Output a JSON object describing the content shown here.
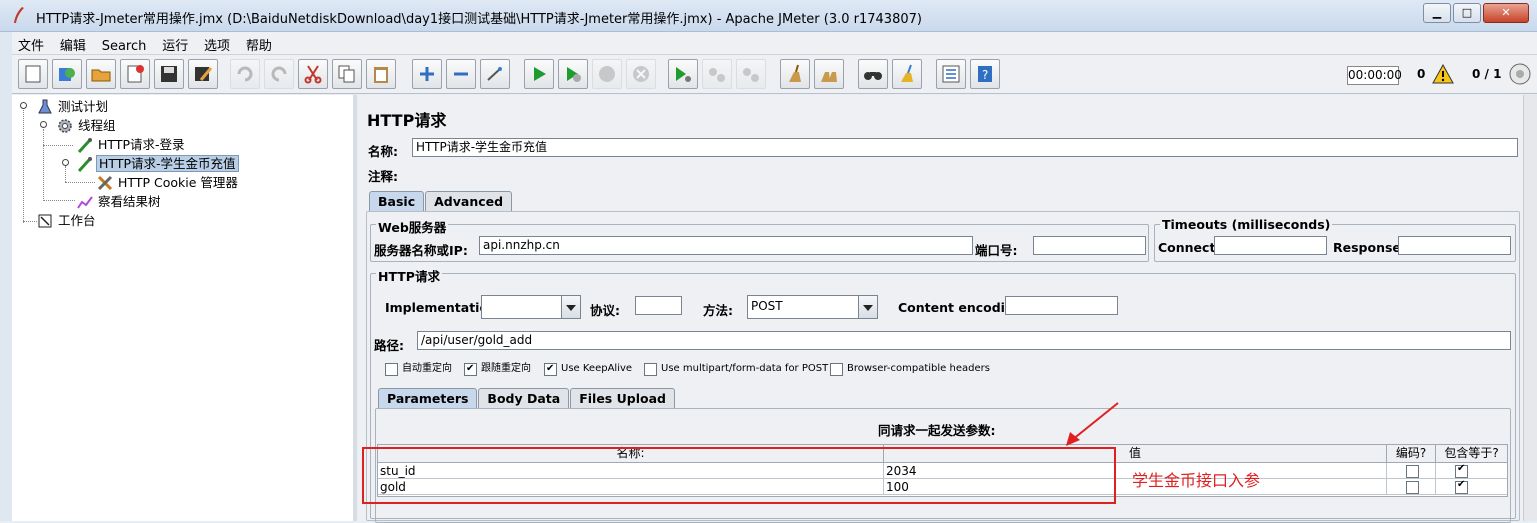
{
  "window": {
    "title": "HTTP请求-Jmeter常用操作.jmx (D:\\BaiduNetdiskDownload\\day1接口测试基础\\HTTP请求-Jmeter常用操作.jmx) - Apache JMeter (3.0 r1743807)",
    "minimize": "▁",
    "maximize": "□",
    "close": "✕"
  },
  "menu": [
    "文件",
    "编辑",
    "Search",
    "运行",
    "选项",
    "帮助"
  ],
  "toolbar_status": {
    "timer": "00:00:00",
    "errors": "0",
    "threads": "0 / 1"
  },
  "tree": {
    "test_plan": "测试计划",
    "thread_group": "线程组",
    "http_login": "HTTP请求-登录",
    "http_gold": "HTTP请求-学生金币充值",
    "cookie_manager": "HTTP Cookie 管理器",
    "result_tree": "察看结果树",
    "workbench": "工作台"
  },
  "panel": {
    "title": "HTTP请求",
    "name_label": "名称:",
    "name_value": "HTTP请求-学生金币充值",
    "comment_label": "注释:",
    "comment_value": ""
  },
  "tabs": [
    "Basic",
    "Advanced"
  ],
  "web_server": {
    "group_title": "Web服务器",
    "server_label": "服务器名称或IP:",
    "server_value": "api.nnzhp.cn",
    "port_label": "端口号:",
    "port_value": ""
  },
  "timeouts": {
    "group_title": "Timeouts (milliseconds)",
    "connect_label": "Connect:",
    "connect_value": "",
    "response_label": "Response:",
    "response_value": ""
  },
  "http_request": {
    "group_title": "HTTP请求",
    "impl_label": "Implementation:",
    "impl_value": "",
    "protocol_label": "协议:",
    "protocol_value": "",
    "method_label": "方法:",
    "method_value": "POST",
    "encoding_label": "Content encoding:",
    "encoding_value": "",
    "path_label": "路径:",
    "path_value": "/api/user/gold_add"
  },
  "options": [
    {
      "label": "自动重定向",
      "checked": false
    },
    {
      "label": "跟随重定向",
      "checked": true
    },
    {
      "label": "Use KeepAlive",
      "checked": true
    },
    {
      "label": "Use multipart/form-data for POST",
      "checked": false
    },
    {
      "label": "Browser-compatible headers",
      "checked": false
    }
  ],
  "param_tabs": [
    "Parameters",
    "Body Data",
    "Files Upload"
  ],
  "params": {
    "header": "同请求一起发送参数:",
    "columns": [
      "名称:",
      "值",
      "编码?",
      "包含等于?"
    ],
    "rows": [
      {
        "name": "stu_id",
        "value": "2034",
        "encode": false,
        "include_equals": true
      },
      {
        "name": "gold",
        "value": "100",
        "encode": false,
        "include_equals": true
      }
    ]
  },
  "annotation": "学生金币接口入参",
  "colors": {
    "annotation": "#e02020",
    "selection": "#b8cfe5",
    "active_tab": "#c8d8ec"
  }
}
